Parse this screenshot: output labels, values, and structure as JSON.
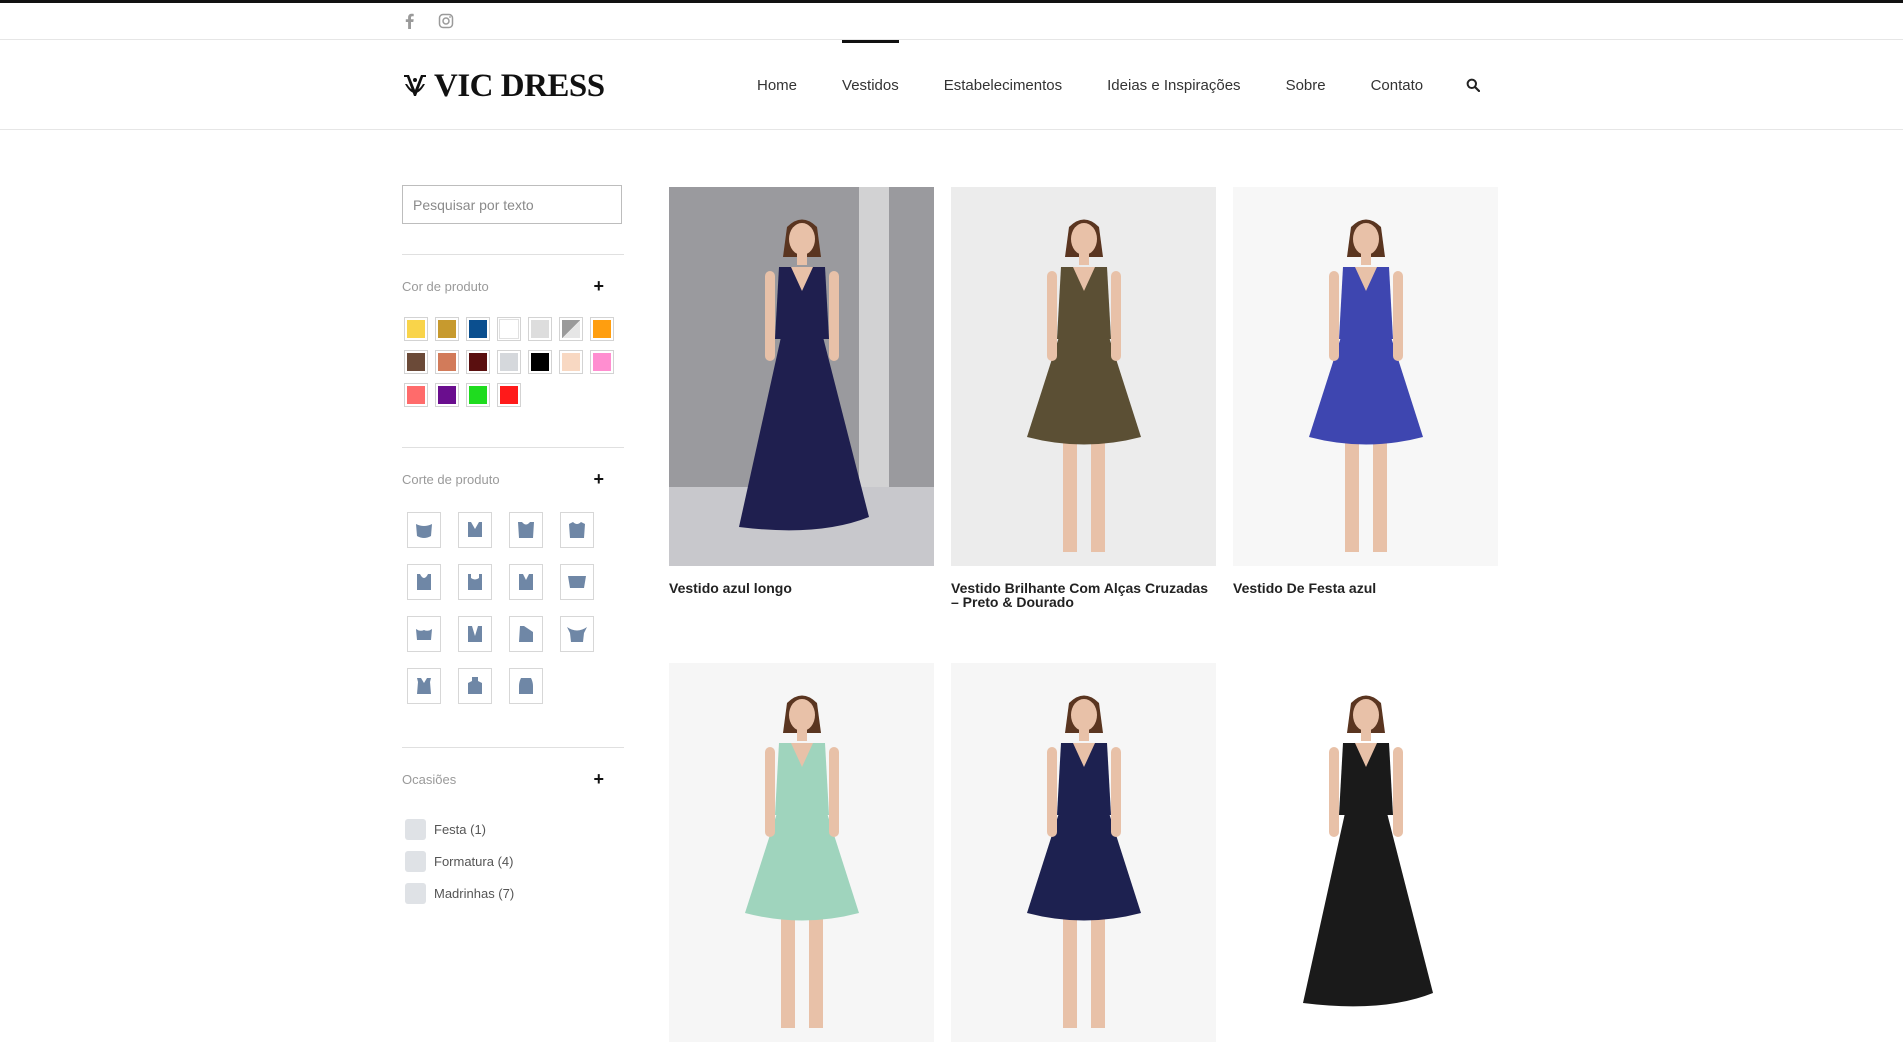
{
  "social": {
    "facebook_icon": "facebook-icon",
    "instagram_icon": "instagram-icon"
  },
  "brand": {
    "logo_text": "VIC DRESS"
  },
  "nav": {
    "items": [
      {
        "label": "Home",
        "active": false
      },
      {
        "label": "Vestidos",
        "active": true
      },
      {
        "label": "Estabelecimentos",
        "active": false
      },
      {
        "label": "Ideias e Inspirações",
        "active": false
      },
      {
        "label": "Sobre",
        "active": false
      },
      {
        "label": "Contato",
        "active": false
      }
    ],
    "search_icon": "search-icon"
  },
  "sidebar": {
    "search": {
      "placeholder": "Pesquisar por texto"
    },
    "color_filter": {
      "title": "Cor de produto",
      "toggle": "+",
      "colors": [
        "#f9d44a",
        "#c79a2e",
        "#0b4f8f",
        "#ffffff",
        "#dddddd",
        "split-gray",
        "#ff9e0f",
        "#6b4a38",
        "#d27b5a",
        "#5a0f0f",
        "#d5d8dc",
        "#000000",
        "#f8d8c2",
        "#ff8ed0",
        "#ff6b6b",
        "#6a0e8e",
        "#1fdc1f",
        "#ff1a1a"
      ]
    },
    "cut_filter": {
      "title": "Corte de produto",
      "toggle": "+",
      "count": 15
    },
    "occasion_filter": {
      "title": "Ocasiões",
      "toggle": "+",
      "options": [
        {
          "label": "Festa (1)"
        },
        {
          "label": "Formatura (4)"
        },
        {
          "label": "Madrinhas (7)"
        }
      ]
    }
  },
  "products": [
    {
      "name": "Vestido azul longo",
      "dress_color": "#1f1f4f",
      "bg": "#9a9a9e"
    },
    {
      "name": "Vestido Brilhante Com Alças Cruzadas – Preto & Dourado",
      "dress_color": "#5b4f34",
      "bg": "#ececec"
    },
    {
      "name": "Vestido De Festa azul",
      "dress_color": "#3e46b0",
      "bg": "#f7f7f7"
    },
    {
      "name": "",
      "dress_color": "#9fd4bd",
      "bg": "#f6f6f6"
    },
    {
      "name": "",
      "dress_color": "#1d2150",
      "bg": "#f6f6f6"
    },
    {
      "name": "",
      "dress_color": "#1a1a1a",
      "bg": "#ffffff"
    }
  ]
}
